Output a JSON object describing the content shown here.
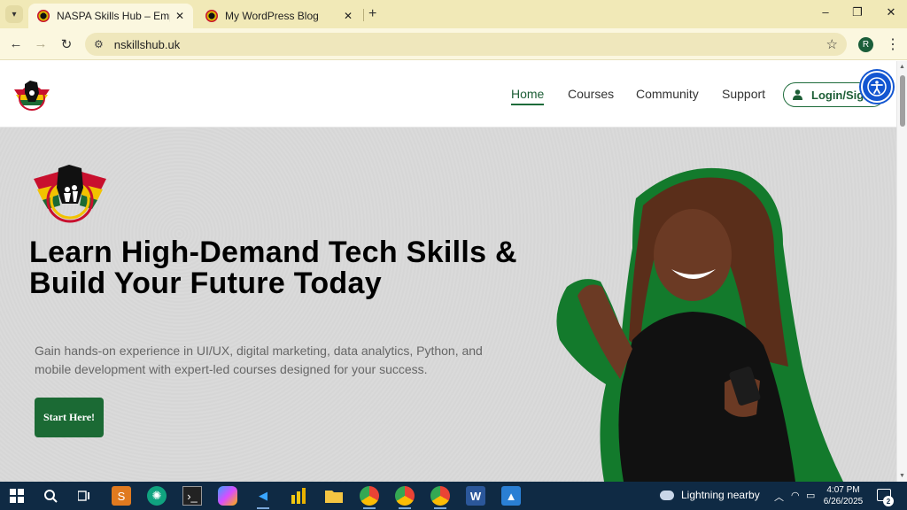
{
  "browser": {
    "tabs": [
      {
        "title": "NASPA Skills Hub – Empowering",
        "close": "✕"
      },
      {
        "title": "My WordPress Blog",
        "close": "✕"
      }
    ],
    "new_tab": "+",
    "window_controls": {
      "minimize": "–",
      "restore": "❐",
      "close": "✕"
    },
    "url": "nskillshub.uk",
    "profile_initial": "R",
    "icons": [
      "tab-search-icon",
      "back-icon",
      "forward-icon",
      "reload-icon",
      "site-settings-icon",
      "bookmark-star-icon",
      "menu-kebab-icon"
    ]
  },
  "site": {
    "nav": {
      "items": [
        "Home",
        "Courses",
        "Community",
        "Support"
      ],
      "active": "Home",
      "login_label": "Login/Sign-"
    },
    "hero": {
      "title": "Learn High-Demand Tech Skills & Build Your Future Today",
      "subtitle": "Gain hands-on experience in UI/UX, digital marketing, data analytics, Python, and mobile development with expert-led courses designed for your success.",
      "cta_label": "Start Here!"
    },
    "colors": {
      "brand_green": "#1b6a34",
      "accessibility_blue": "#1356d1",
      "gold": "#f2c200",
      "red": "#c8102e"
    }
  },
  "taskbar": {
    "weather_text": "Lightning nearby",
    "time": "4:07 PM",
    "date": "6/26/2025",
    "notification_count": "2",
    "apps": [
      "windows-start-icon",
      "search-icon",
      "task-view-icon",
      "sublime-icon",
      "chatgpt-icon",
      "terminal-icon",
      "copilot-icon",
      "vscode-icon",
      "power-bi-icon",
      "file-explorer-icon",
      "chrome-icon",
      "chrome-profile-icon",
      "chrome-r-icon",
      "word-icon",
      "photos-icon"
    ]
  }
}
